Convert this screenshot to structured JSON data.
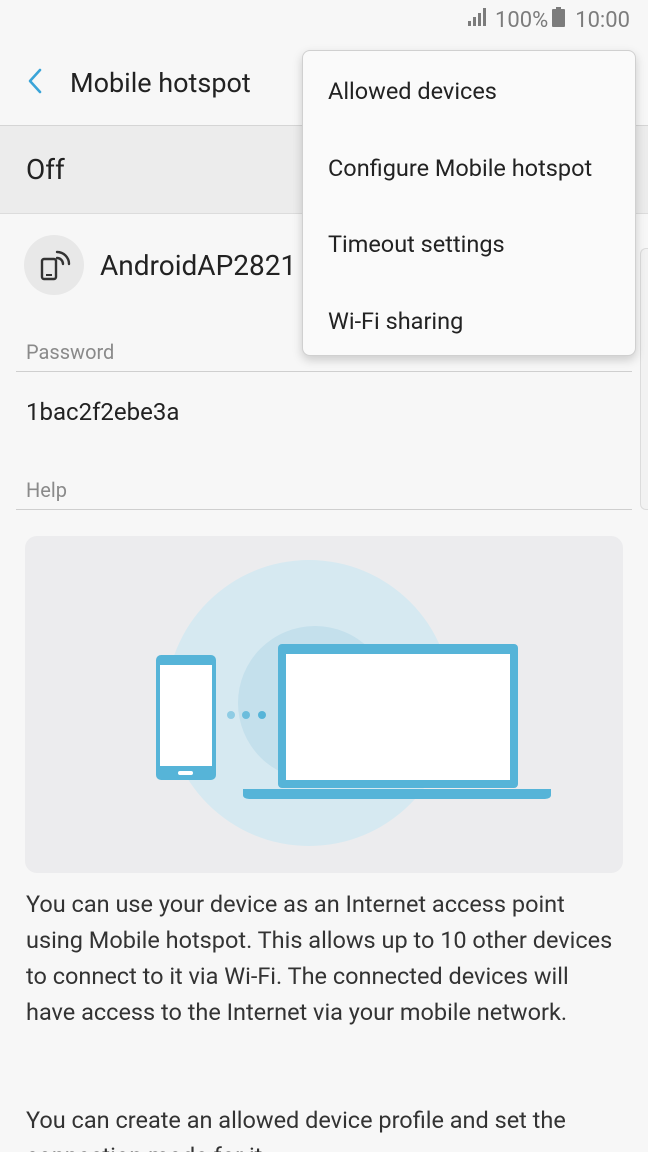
{
  "status": {
    "signal_icon": "signal-icon",
    "battery_text": "100%",
    "battery_icon": "battery-icon",
    "time": "10:00"
  },
  "header": {
    "back_icon": "chevron-left-icon",
    "title": "Mobile hotspot"
  },
  "switch": {
    "label": "Off"
  },
  "network": {
    "icon": "hotspot-icon",
    "name": "AndroidAP2821"
  },
  "password": {
    "label": "Password",
    "value": "1bac2f2ebe3a"
  },
  "help": {
    "label": "Help",
    "paragraph1": "You can use your device as an Internet access point using Mobile hotspot. This allows up to 10 other devices to connect to it via Wi-Fi. The connected devices will have access to the Internet via your mobile network.",
    "paragraph2": "You can create an allowed device profile and set the connection mode for it."
  },
  "menu": {
    "items": [
      {
        "label": "Allowed devices"
      },
      {
        "label": "Configure Mobile hotspot"
      },
      {
        "label": "Timeout settings"
      },
      {
        "label": "Wi-Fi sharing"
      }
    ]
  },
  "colors": {
    "accent": "#3aa4d8",
    "illustration_blue": "#56b4d8",
    "illustration_light": "#d4e8f0"
  }
}
